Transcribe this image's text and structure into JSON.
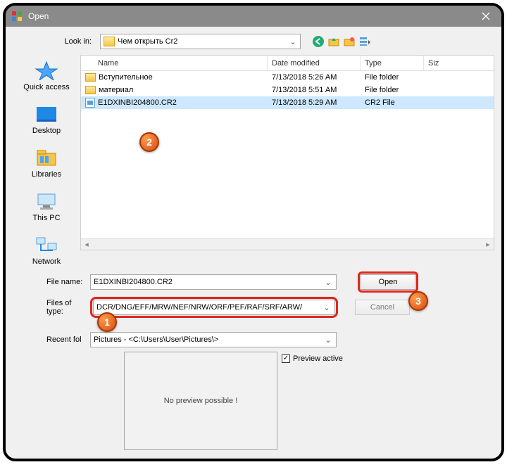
{
  "window": {
    "title": "Open"
  },
  "toolbar": {
    "lookin_label": "Look in:",
    "folder": "Чем открыть Cr2"
  },
  "places": {
    "quick": "Quick access",
    "desktop": "Desktop",
    "libraries": "Libraries",
    "thispc": "This PC",
    "network": "Network"
  },
  "columns": {
    "name": "Name",
    "date": "Date modified",
    "type": "Type",
    "size": "Siz"
  },
  "rows": [
    {
      "name": "Вступительное",
      "date": "7/13/2018 5:26 AM",
      "type": "File folder",
      "icon": "folder"
    },
    {
      "name": "материал",
      "date": "7/13/2018 5:51 AM",
      "type": "File folder",
      "icon": "folder"
    },
    {
      "name": "E1DXINBI204800.CR2",
      "date": "7/13/2018 5:29 AM",
      "type": "CR2 File",
      "icon": "file",
      "selected": true
    }
  ],
  "form": {
    "filename_label": "File name:",
    "filename_value": "E1DXINBI204800.CR2",
    "filetype_label": "Files of type:",
    "filetype_value": "DCR/DNG/EFF/MRW/NEF/NRW/ORF/PEF/RAF/SRF/ARW/",
    "recent_label": "Recent fol",
    "recent_value": "Pictures  -  <C:\\Users\\User\\Pictures\\>",
    "open_btn": "Open",
    "cancel_btn": "Cancel"
  },
  "preview": {
    "none": "No preview possible !",
    "active_label": "Preview active"
  },
  "badges": {
    "b1": "1",
    "b2": "2",
    "b3": "3"
  }
}
